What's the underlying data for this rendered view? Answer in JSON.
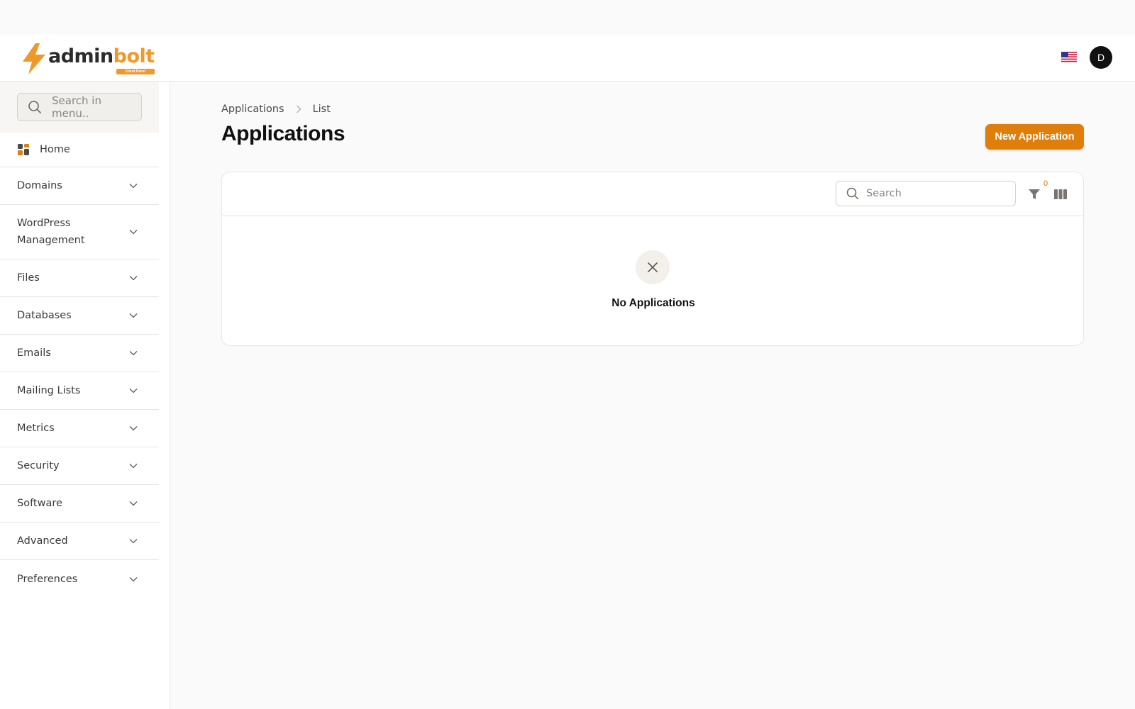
{
  "header": {
    "logo_text_part1": "admin",
    "logo_text_part2": "bolt",
    "logo_subtitle": "Client Panel",
    "avatar_initial": "D",
    "brand_color": "#f0982a"
  },
  "sidebar": {
    "search_placeholder": "Search in menu..",
    "items": [
      {
        "label": "Home",
        "icon": "home-grid-icon"
      },
      {
        "label": "Domains"
      },
      {
        "label": "WordPress Management"
      },
      {
        "label": "Files"
      },
      {
        "label": "Databases"
      },
      {
        "label": "Emails"
      },
      {
        "label": "Mailing Lists"
      },
      {
        "label": "Metrics"
      },
      {
        "label": "Security"
      },
      {
        "label": "Software"
      },
      {
        "label": "Advanced"
      },
      {
        "label": "Preferences"
      }
    ]
  },
  "main": {
    "breadcrumb": [
      "Applications",
      "List"
    ],
    "title": "Applications",
    "new_button_label": "New Application",
    "accent_color": "#e07e0c",
    "table": {
      "search_placeholder": "Search",
      "filter_count": "0",
      "empty_text": "No Applications"
    }
  }
}
